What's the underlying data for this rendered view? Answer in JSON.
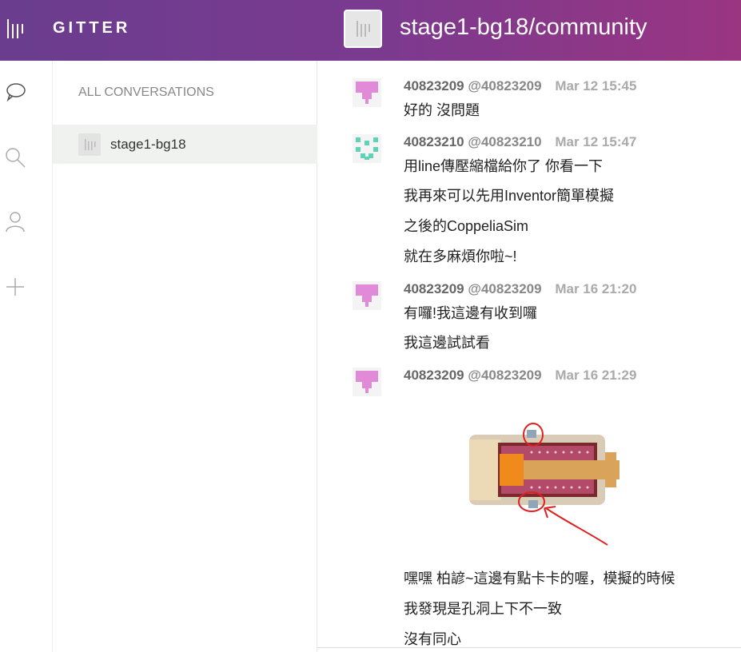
{
  "brand": {
    "name": "GITTER"
  },
  "room": {
    "title": "stage1-bg18/community"
  },
  "sidebar_icons": [
    "speech-bubble-icon",
    "search-icon",
    "user-icon",
    "plus-icon"
  ],
  "left_panel": {
    "header": "ALL CONVERSATIONS",
    "items": [
      {
        "label": "stage1-bg18"
      }
    ]
  },
  "messages": [
    {
      "user": "40823209",
      "handle": "@40823209",
      "time": "Mar 12 15:45",
      "lines": [
        "好的 沒問題"
      ]
    },
    {
      "user": "40823210",
      "handle": "@40823210",
      "time": "Mar 12 15:47",
      "lines": [
        "用line傳壓縮檔給你了 你看一下",
        "我再來可以先用Inventor簡單模擬",
        "之後的CoppeliaSim",
        "就在多麻煩你啦~!"
      ]
    },
    {
      "user": "40823209",
      "handle": "@40823209",
      "time": "Mar 16 21:20",
      "lines": [
        "有囉!我這邊有收到囉",
        "我這邊試試看"
      ]
    },
    {
      "user": "40823209",
      "handle": "@40823209",
      "time": "Mar 16 21:29",
      "lines": [
        "嘿嘿 柏諺~這邊有點卡卡的喔，模擬的時候",
        "我發現是孔洞上下不一致",
        "沒有同心"
      ]
    }
  ],
  "colors": {
    "topbar_start": "#6a3d8f",
    "topbar_end": "#9a3582",
    "avatar_pink": "#e08ad8",
    "avatar_teal": "#5fd3b8"
  }
}
